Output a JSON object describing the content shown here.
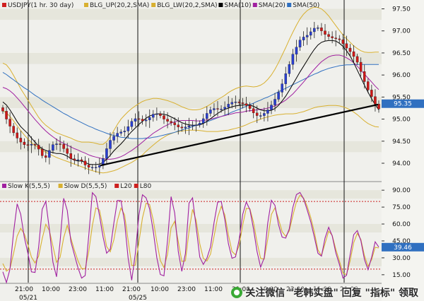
{
  "chart_data": [
    {
      "type": "candlestick",
      "legend": [
        {
          "label": "USDJPY(1 hr. 30 day)",
          "color": "#d02020"
        },
        {
          "label": "BLG_UP(20,2,SMA)",
          "color": "#d8b030"
        },
        {
          "label": "BLG_LW(20,2,SMA)",
          "color": "#d8b030"
        },
        {
          "label": "SMA(10)",
          "color": "#000000"
        },
        {
          "label": "SMA(20)",
          "color": "#a020a0"
        },
        {
          "label": "SMA(50)",
          "color": "#3070c0"
        }
      ],
      "ylim": [
        93.6,
        97.7
      ],
      "y_ticks": [
        "97.50",
        "97.00",
        "96.50",
        "96.00",
        "95.50",
        "95.00",
        "94.50",
        "94.00"
      ],
      "last_price": "95.35",
      "price_close": [
        95.18,
        95.0,
        94.84,
        94.69,
        94.57,
        94.48,
        94.42,
        94.41,
        94.43,
        94.41,
        94.32,
        94.17,
        94.13,
        94.29,
        94.42,
        94.44,
        94.43,
        94.33,
        94.22,
        94.1,
        94.07,
        94.08,
        94.05,
        93.96,
        93.91,
        93.91,
        93.91,
        93.95,
        94.11,
        94.33,
        94.52,
        94.61,
        94.68,
        94.71,
        94.73,
        94.83,
        94.95,
        95.01,
        95.0,
        94.96,
        94.98,
        95.04,
        95.11,
        95.12,
        95.08,
        95.0,
        94.95,
        94.92,
        94.87,
        94.82,
        94.8,
        94.82,
        94.85,
        94.86,
        94.87,
        94.91,
        95.01,
        95.13,
        95.21,
        95.24,
        95.23,
        95.23,
        95.27,
        95.34,
        95.38,
        95.39,
        95.37,
        95.35,
        95.31,
        95.24,
        95.14,
        95.08,
        95.08,
        95.13,
        95.21,
        95.32,
        95.45,
        95.61,
        95.8,
        96.03,
        96.24,
        96.47,
        96.63,
        96.79,
        96.86,
        96.9,
        96.98,
        97.06,
        97.07,
        97.0,
        96.92,
        96.87,
        96.84,
        96.82,
        96.8,
        96.71,
        96.61,
        96.53,
        96.42,
        96.29,
        96.08,
        95.85,
        95.66,
        95.51,
        95.34,
        95.23
      ],
      "price_sma10": [
        95.39,
        95.32,
        95.21,
        95.08,
        94.94,
        94.83,
        94.75,
        94.67,
        94.57,
        94.48,
        94.39,
        94.33,
        94.29,
        94.26,
        94.24,
        94.22,
        94.22,
        94.2,
        94.16,
        94.11,
        94.07,
        94.05,
        94.05,
        94.02,
        93.98,
        93.97,
        93.97,
        93.98,
        94.02,
        94.09,
        94.18,
        94.28,
        94.36,
        94.44,
        94.53,
        94.63,
        94.72,
        94.8,
        94.88,
        94.95,
        95.02,
        95.07,
        95.1,
        95.12,
        95.12,
        95.11,
        95.09,
        95.05,
        95.01,
        94.96,
        94.92,
        94.89,
        94.87,
        94.86,
        94.86,
        94.87,
        94.9,
        94.95,
        95.01,
        95.07,
        95.13,
        95.18,
        95.22,
        95.25,
        95.28,
        95.3,
        95.31,
        95.32,
        95.33,
        95.32,
        95.29,
        95.25,
        95.21,
        95.19,
        95.19,
        95.2,
        95.24,
        95.31,
        95.41,
        95.52,
        95.65,
        95.79,
        95.93,
        96.07,
        96.2,
        96.33,
        96.46,
        96.58,
        96.68,
        96.74,
        96.77,
        96.78,
        96.78,
        96.77,
        96.72,
        96.65,
        96.55,
        96.43,
        96.28,
        96.11,
        95.94,
        95.77,
        95.61,
        95.46,
        95.33,
        95.21
      ],
      "price_sma20": [
        95.72,
        95.69,
        95.64,
        95.57,
        95.48,
        95.39,
        95.29,
        95.19,
        95.09,
        94.99,
        94.9,
        94.81,
        94.73,
        94.66,
        94.6,
        94.54,
        94.49,
        94.45,
        94.41,
        94.37,
        94.33,
        94.3,
        94.26,
        94.23,
        94.19,
        94.16,
        94.14,
        94.12,
        94.1,
        94.09,
        94.09,
        94.1,
        94.12,
        94.15,
        94.19,
        94.24,
        94.29,
        94.35,
        94.41,
        94.48,
        94.55,
        94.61,
        94.68,
        94.73,
        94.78,
        94.83,
        94.87,
        94.91,
        94.94,
        94.96,
        94.97,
        94.97,
        94.97,
        94.97,
        94.96,
        94.96,
        94.97,
        94.98,
        95.0,
        95.02,
        95.04,
        95.06,
        95.08,
        95.1,
        95.12,
        95.14,
        95.15,
        95.16,
        95.18,
        95.19,
        95.2,
        95.21,
        95.22,
        95.23,
        95.25,
        95.27,
        95.3,
        95.34,
        95.38,
        95.43,
        95.5,
        95.57,
        95.66,
        95.75,
        95.84,
        95.94,
        96.04,
        96.13,
        96.22,
        96.3,
        96.36,
        96.41,
        96.44,
        96.45,
        96.45,
        96.43,
        96.39,
        96.34,
        96.28,
        96.2,
        96.11,
        96.02,
        95.93,
        95.84,
        95.75,
        95.67
      ],
      "price_sma50": [
        96.06,
        96.01,
        95.95,
        95.89,
        95.83,
        95.77,
        95.71,
        95.66,
        95.6,
        95.54,
        95.49,
        95.43,
        95.38,
        95.33,
        95.28,
        95.23,
        95.18,
        95.13,
        95.09,
        95.04,
        95.0,
        94.96,
        94.92,
        94.88,
        94.84,
        94.81,
        94.77,
        94.74,
        94.71,
        94.68,
        94.65,
        94.63,
        94.61,
        94.59,
        94.58,
        94.57,
        94.56,
        94.56,
        94.56,
        94.56,
        94.57,
        94.57,
        94.59,
        94.6,
        94.62,
        94.64,
        94.66,
        94.68,
        94.7,
        94.73,
        94.75,
        94.78,
        94.8,
        94.83,
        94.86,
        94.89,
        94.91,
        94.94,
        94.97,
        95.0,
        95.03,
        95.06,
        95.09,
        95.12,
        95.16,
        95.19,
        95.22,
        95.26,
        95.29,
        95.33,
        95.36,
        95.4,
        95.43,
        95.47,
        95.5,
        95.54,
        95.58,
        95.62,
        95.66,
        95.7,
        95.74,
        95.78,
        95.82,
        95.86,
        95.9,
        95.94,
        95.98,
        96.02,
        96.05,
        96.09,
        96.12,
        96.15,
        96.17,
        96.19,
        96.21,
        96.22,
        96.23,
        96.23,
        96.24,
        96.24,
        96.24,
        96.24,
        96.24,
        96.24,
        96.24,
        96.24
      ],
      "price_bb_up": [
        96.27,
        96.23,
        96.13,
        95.99,
        95.84,
        95.69,
        95.56,
        95.43,
        95.3,
        95.17,
        95.04,
        94.94,
        94.86,
        94.8,
        94.74,
        94.69,
        94.66,
        94.63,
        94.6,
        94.57,
        94.53,
        94.5,
        94.48,
        94.48,
        94.48,
        94.47,
        94.45,
        94.43,
        94.43,
        94.49,
        94.6,
        94.74,
        94.88,
        95.0,
        95.09,
        95.17,
        95.24,
        95.3,
        95.35,
        95.4,
        95.43,
        95.45,
        95.47,
        95.47,
        95.46,
        95.44,
        95.42,
        95.39,
        95.36,
        95.32,
        95.28,
        95.25,
        95.22,
        95.21,
        95.21,
        95.22,
        95.25,
        95.29,
        95.34,
        95.39,
        95.44,
        95.49,
        95.54,
        95.6,
        95.65,
        95.69,
        95.72,
        95.74,
        95.75,
        95.74,
        95.73,
        95.74,
        95.77,
        95.82,
        95.9,
        96.0,
        96.13,
        96.28,
        96.45,
        96.62,
        96.8,
        96.97,
        97.13,
        97.27,
        97.38,
        97.46,
        97.51,
        97.54,
        97.53,
        97.5,
        97.43,
        97.34,
        97.23,
        97.12,
        97.01,
        96.91,
        96.82,
        96.74,
        96.66,
        96.6,
        96.55,
        96.52,
        96.51,
        96.51,
        96.52,
        96.52
      ],
      "price_bb_lw": [
        95.19,
        95.14,
        95.06,
        94.96,
        94.85,
        94.74,
        94.64,
        94.55,
        94.47,
        94.4,
        94.35,
        94.3,
        94.25,
        94.21,
        94.17,
        94.13,
        94.1,
        94.07,
        94.04,
        94.01,
        93.98,
        93.95,
        93.92,
        93.89,
        93.86,
        93.83,
        93.81,
        93.79,
        93.78,
        93.79,
        93.81,
        93.83,
        93.86,
        93.9,
        93.94,
        93.98,
        94.02,
        94.07,
        94.13,
        94.19,
        94.27,
        94.34,
        94.41,
        94.48,
        94.54,
        94.59,
        94.64,
        94.67,
        94.7,
        94.72,
        94.73,
        94.74,
        94.75,
        94.75,
        94.75,
        94.74,
        94.73,
        94.72,
        94.72,
        94.72,
        94.72,
        94.73,
        94.74,
        94.75,
        94.77,
        94.79,
        94.81,
        94.84,
        94.87,
        94.91,
        94.94,
        94.97,
        95.0,
        95.03,
        95.05,
        95.07,
        95.09,
        95.1,
        95.11,
        95.12,
        95.12,
        95.12,
        95.13,
        95.15,
        95.17,
        95.2,
        95.23,
        95.26,
        95.28,
        95.29,
        95.3,
        95.31,
        95.31,
        95.31,
        95.3,
        95.28,
        95.25,
        95.21,
        95.16,
        95.1,
        95.03,
        94.96,
        94.9,
        94.86,
        94.83,
        94.82
      ],
      "trendline": [
        [
          142,
          95.32
        ],
        [
          535,
          95.24
        ]
      ]
    },
    {
      "type": "line",
      "legend": [
        {
          "label": "Slow K(5,5,5)",
          "color": "#a020a0"
        },
        {
          "label": "Slow D(5,5,5)",
          "color": "#d8b030"
        },
        {
          "label": "L20",
          "color": "#cc2020"
        },
        {
          "label": "L80",
          "color": "#cc2020"
        }
      ],
      "ylim": [
        8,
        97
      ],
      "y_ticks": [
        "90.00",
        "75.00",
        "60.00",
        "45.00",
        "30.00",
        "15.00"
      ],
      "last_value": "39.46",
      "levels": [
        20,
        80
      ],
      "slow_k": [
        17.6,
        8.1,
        19.9,
        52.7,
        77.9,
        68.7,
        48.2,
        34.0,
        17.5,
        17.0,
        39.7,
        73.1,
        80.1,
        55.1,
        26.2,
        13.2,
        44.9,
        82.8,
        72.0,
        44.4,
        32.7,
        21.1,
        12.0,
        14.3,
        49.8,
        87.8,
        84.3,
        67.4,
        48.4,
        34.1,
        37.6,
        60.8,
        80.9,
        80.7,
        61.7,
        29.8,
        10.1,
        33.8,
        67.6,
        85.9,
        83.3,
        73.3,
        54.0,
        30.2,
        15.2,
        14.0,
        45.6,
        84.3,
        69.8,
        35.6,
        18.0,
        33.9,
        78.6,
        83.2,
        57.1,
        30.6,
        24.2,
        29.7,
        39.7,
        61.3,
        79.4,
        80.0,
        64.1,
        42.6,
        29.6,
        30.8,
        46.0,
        68.7,
        79.5,
        72.8,
        55.7,
        35.7,
        21.7,
        30.0,
        60.9,
        81.1,
        76.5,
        59.5,
        48.4,
        47.5,
        55.6,
        74.7,
        86.1,
        88.0,
        82.4,
        72.4,
        62.0,
        48.5,
        34.1,
        31.5,
        47.6,
        57.1,
        49.5,
        34.4,
        24.2,
        12.1,
        14.5,
        32.9,
        50.5,
        54.2,
        45.1,
        28.6,
        19.5,
        30.5,
        44.2,
        39.5
      ],
      "slow_d": [
        24.9,
        18.2,
        20.4,
        33.9,
        49.3,
        56.1,
        51.3,
        41.7,
        30.6,
        25.5,
        31.5,
        46.9,
        59.8,
        54.2,
        40.3,
        26.0,
        30.6,
        47.8,
        58.9,
        47.5,
        36.7,
        27.3,
        20.5,
        20.3,
        35.5,
        58.7,
        74.3,
        72.4,
        56.5,
        40.0,
        35.3,
        45.9,
        63.0,
        74.1,
        68.1,
        45.6,
        23.1,
        23.5,
        43.6,
        65.4,
        78.4,
        77.4,
        63.8,
        44.3,
        27.6,
        21.4,
        33.3,
        56.5,
        62.4,
        44.3,
        26.8,
        27.3,
        53.7,
        73.0,
        63.3,
        42.5,
        29.5,
        27.2,
        33.3,
        48.9,
        66.0,
        75.6,
        68.2,
        50.4,
        35.7,
        32.6,
        40.9,
        59.3,
        73.9,
        73.5,
        61.7,
        43.9,
        29.5,
        28.9,
        46.7,
        68.5,
        74.4,
        64.5,
        53.3,
        49.1,
        53.8,
        67.5,
        79.7,
        85.5,
        83.0,
        75.6,
        65.9,
        52.9,
        37.1,
        31.9,
        42.7,
        53.7,
        49.9,
        37.6,
        27.3,
        16.6,
        15.1,
        27.4,
        43.5,
        51.7,
        46.3,
        32.0,
        22.4,
        28.3,
        39.4,
        38.7
      ]
    }
  ],
  "x_axis": {
    "tick_labels": [
      "21:00",
      "10:00",
      "23:00",
      "11:00",
      "21:00",
      "10:00",
      "23:00",
      "11:00",
      "21:00",
      "10:00",
      "23:00",
      "11:00",
      "21:00"
    ],
    "date_labels": [
      "05/21",
      "05/25"
    ]
  },
  "watermark": "关注微信 \"老韩实盘\" 回复 \"指标\" 领取",
  "colors": {
    "background": "#f0f0ec",
    "band": "#e6e6dc",
    "up_candle": "#2a3fd0",
    "down_candle": "#d01818",
    "wick": "#222222",
    "trend": "#000000",
    "level": "#cc2020",
    "badge": "#3070c0",
    "separator": "#111111"
  }
}
